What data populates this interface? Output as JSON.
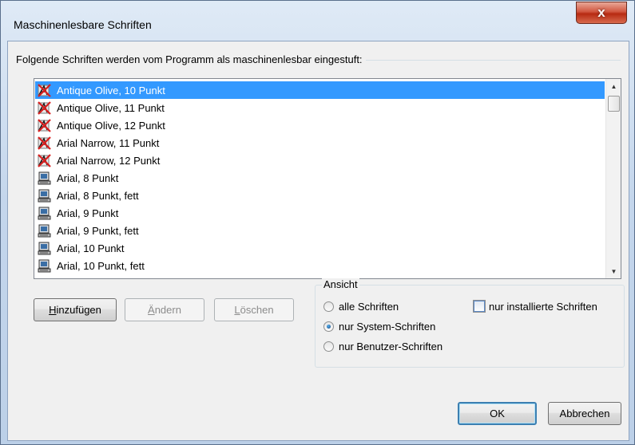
{
  "window": {
    "title": "Maschinenlesbare Schriften",
    "close_glyph": "x"
  },
  "prompt": "Folgende Schriften werden vom Programm als maschinenlesbar eingestuft:",
  "fonts": [
    {
      "label": "Antique Olive, 10 Punkt",
      "icon": "truetype-font-icon",
      "selected": true
    },
    {
      "label": "Antique Olive, 11 Punkt",
      "icon": "truetype-font-icon",
      "selected": false
    },
    {
      "label": "Antique Olive, 12 Punkt",
      "icon": "truetype-font-icon",
      "selected": false
    },
    {
      "label": "Arial Narrow, 11 Punkt",
      "icon": "truetype-font-icon",
      "selected": false
    },
    {
      "label": "Arial Narrow, 12 Punkt",
      "icon": "truetype-font-icon",
      "selected": false
    },
    {
      "label": "Arial,  8 Punkt",
      "icon": "system-font-icon",
      "selected": false
    },
    {
      "label": "Arial,  8 Punkt, fett",
      "icon": "system-font-icon",
      "selected": false
    },
    {
      "label": "Arial,  9 Punkt",
      "icon": "system-font-icon",
      "selected": false
    },
    {
      "label": "Arial,  9 Punkt, fett",
      "icon": "system-font-icon",
      "selected": false
    },
    {
      "label": "Arial, 10 Punkt",
      "icon": "system-font-icon",
      "selected": false
    },
    {
      "label": "Arial, 10 Punkt, fett",
      "icon": "system-font-icon",
      "selected": false
    }
  ],
  "buttons": {
    "add": {
      "mnemonic": "H",
      "rest": "inzufügen"
    },
    "edit": {
      "mnemonic": "Ä",
      "rest": "ndern"
    },
    "delete": {
      "mnemonic": "L",
      "rest": "öschen"
    },
    "ok": "OK",
    "cancel": "Abbrechen"
  },
  "view": {
    "label": "Ansicht",
    "options": {
      "all": "alle Schriften",
      "system": "nur System-Schriften",
      "user": "nur Benutzer-Schriften"
    },
    "selected": "system",
    "installed_only_label": "nur installierte Schriften",
    "installed_only_checked": false
  },
  "colors": {
    "selection": "#3399ff",
    "close_button": "#c7432a"
  }
}
